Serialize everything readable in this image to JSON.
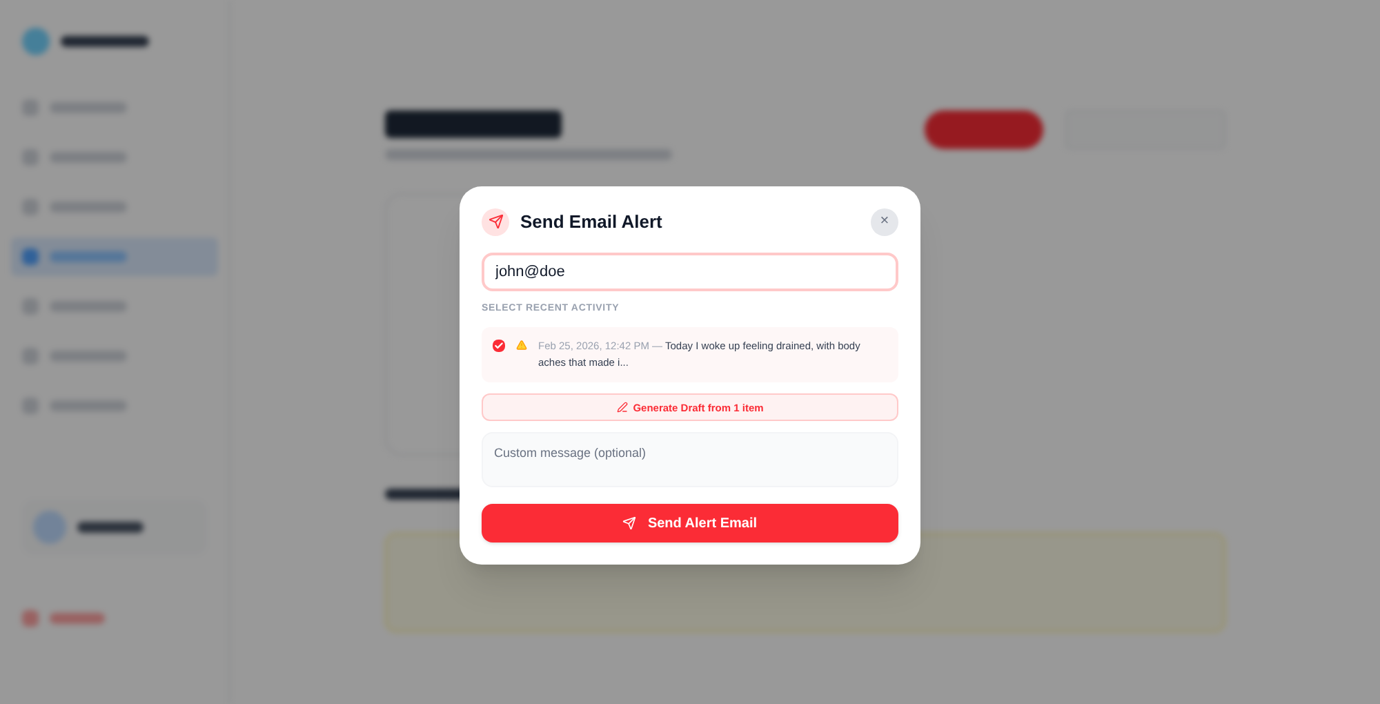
{
  "dialog": {
    "title": "Send Email Alert",
    "email": {
      "value": "john@doe"
    },
    "section_label": "SELECT RECENT ACTIVITY",
    "activities": [
      {
        "checked": true,
        "timestamp": "Feb 25, 2026, 12:42 PM —",
        "text": "Today I woke up feeling drained, with body aches that made i..."
      }
    ],
    "generate_button": "Generate Draft from 1 item",
    "message": {
      "placeholder": "Custom message (optional)"
    },
    "send_button": "Send Alert Email",
    "close_label": "×"
  }
}
